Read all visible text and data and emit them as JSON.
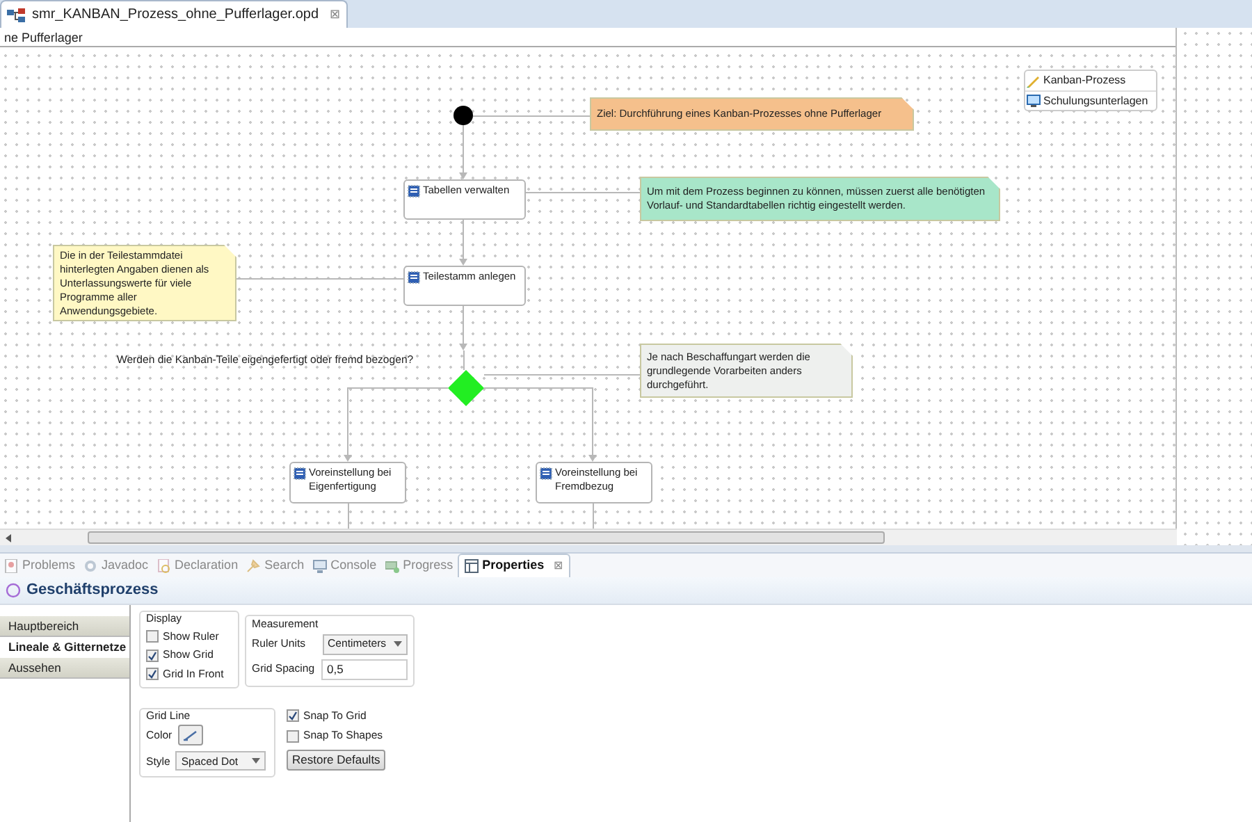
{
  "editor_tab": {
    "title": "smr_KANBAN_Prozess_ohne_Pufferlager.opd",
    "close": "⊠"
  },
  "breadcrumb": "ne Pufferlager",
  "diagram": {
    "nodes": [
      {
        "kind": "start"
      },
      {
        "kind": "note",
        "text": "Ziel: Durchführung eines Kanban-Prozesses ohne Pufferlager",
        "color": "#f5c08c"
      },
      {
        "kind": "task",
        "text": "Tabellen verwalten"
      },
      {
        "kind": "note",
        "text": "Um mit dem Prozess beginnen zu können, müssen zuerst alle benötigten Vorlauf- und Standardtabellen richtig eingestellt werden.",
        "color": "#a8e6c9"
      },
      {
        "kind": "note",
        "text": "Die in der Teilestammdatei hinterlegten Angaben dienen als Unterlassungswerte für viele Programme aller Anwendungsgebiete.",
        "color": "#fff8c4"
      },
      {
        "kind": "task",
        "text": "Teilestamm anlegen"
      },
      {
        "kind": "label",
        "text": "Werden die Kanban-Teile eigengefertigt oder fremd bezogen?"
      },
      {
        "kind": "decision"
      },
      {
        "kind": "note",
        "text": "Je nach Beschaffungart werden die grundlegende Vorarbeiten anders durchgeführt.",
        "color": "#eef0ee"
      },
      {
        "kind": "task",
        "text": "Voreinstellung bei Eigenfertigung"
      },
      {
        "kind": "task",
        "text": "Voreinstellung bei Fremdbezug"
      }
    ],
    "legend": [
      {
        "kind": "pencil",
        "text": "Kanban-Prozess"
      },
      {
        "kind": "monitor",
        "text": "Schulungsunterlagen"
      }
    ]
  },
  "panel_tabs": [
    {
      "label": "Problems",
      "selected": false
    },
    {
      "label": "Javadoc",
      "selected": false
    },
    {
      "label": "Declaration",
      "selected": false
    },
    {
      "label": "Search",
      "selected": false
    },
    {
      "label": "Console",
      "selected": false
    },
    {
      "label": "Progress",
      "selected": false
    },
    {
      "label": "Properties",
      "selected": true
    }
  ],
  "panel_tab_close": "⊠",
  "properties_title": "Geschäftsprozess",
  "sections": [
    {
      "label": "Hauptbereich",
      "selected": false
    },
    {
      "label": "Lineale & Gitternetze",
      "selected": true
    },
    {
      "label": "Aussehen",
      "selected": false
    }
  ],
  "display": {
    "title": "Display",
    "options": [
      {
        "label": "Show Ruler",
        "checked": false
      },
      {
        "label": "Show Grid",
        "checked": true
      },
      {
        "label": "Grid In Front",
        "checked": true
      }
    ]
  },
  "measurement": {
    "title": "Measurement",
    "ruler_units_label": "Ruler Units",
    "ruler_units": "Centimeters",
    "grid_spacing_label": "Grid Spacing",
    "grid_spacing": "0,5"
  },
  "grid_line": {
    "title": "Grid Line",
    "color_label": "Color",
    "style_label": "Style",
    "style": "Spaced Dot"
  },
  "snap": [
    {
      "label": "Snap To Grid",
      "checked": true
    },
    {
      "label": "Snap To Shapes",
      "checked": false
    }
  ],
  "restore_button": "Restore Defaults"
}
